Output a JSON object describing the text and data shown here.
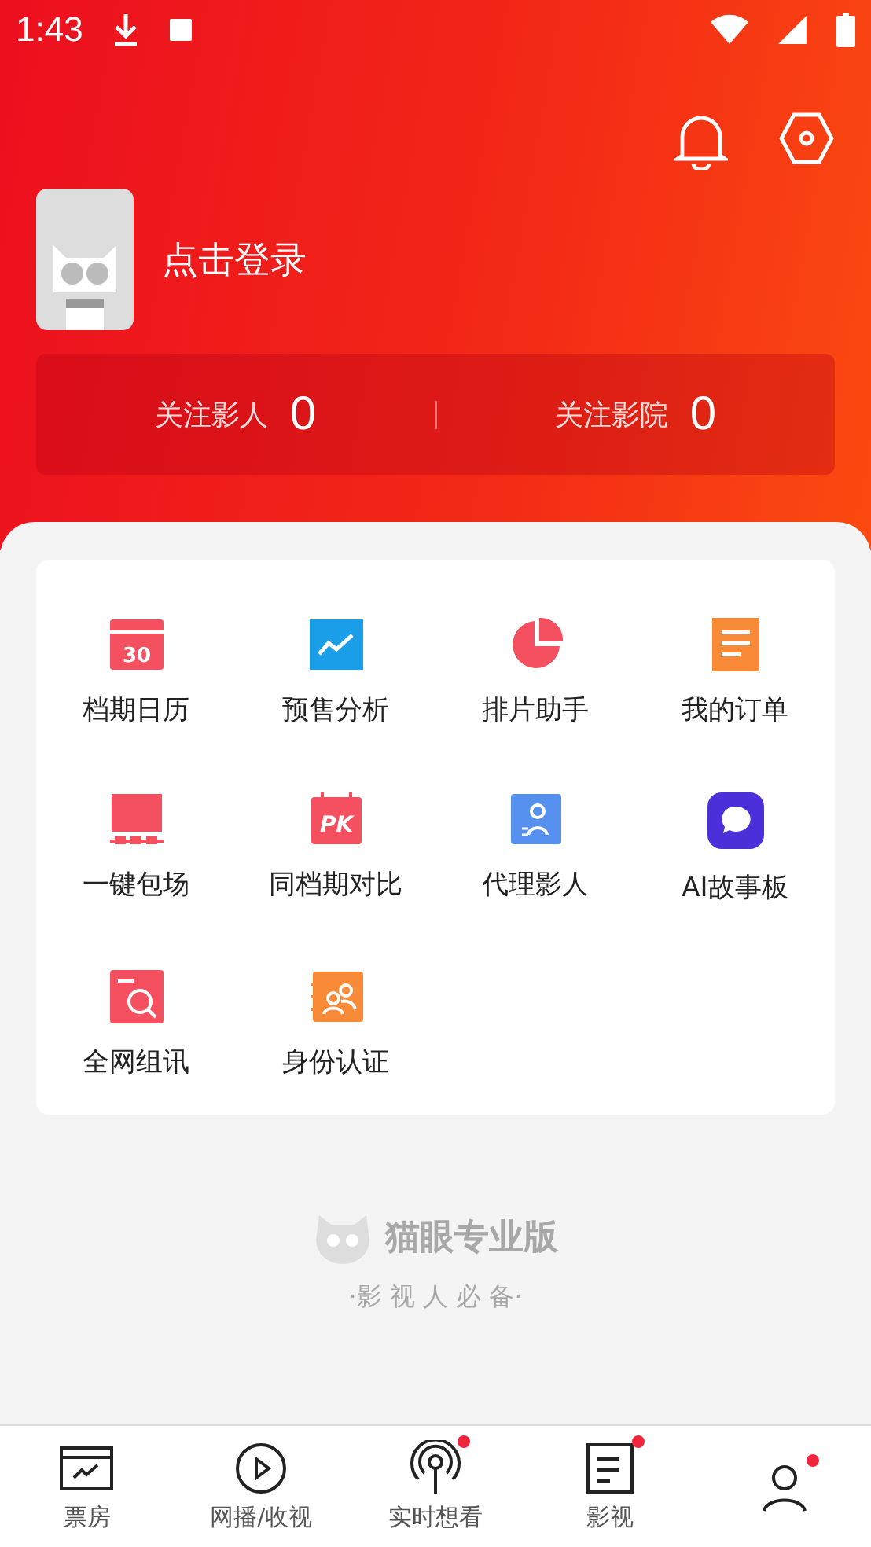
{
  "status_bar": {
    "time": "1:43"
  },
  "profile": {
    "login": "点击登录"
  },
  "stats": [
    {
      "label": "关注影人",
      "value": "0"
    },
    {
      "label": "关注影院",
      "value": "0"
    }
  ],
  "tools": [
    {
      "kind": "calendar",
      "label": "档期日历",
      "icon_text": "30"
    },
    {
      "kind": "trend",
      "label": "预售分析"
    },
    {
      "kind": "pie",
      "label": "排片助手"
    },
    {
      "kind": "order",
      "label": "我的订单"
    },
    {
      "kind": "screen",
      "label": "一键包场"
    },
    {
      "kind": "pk",
      "label": "同档期对比",
      "icon_text": "PK"
    },
    {
      "kind": "agent",
      "label": "代理影人"
    },
    {
      "kind": "chat",
      "label": "AI故事板"
    },
    {
      "kind": "search",
      "label": "全网组讯"
    },
    {
      "kind": "id",
      "label": "身份认证"
    }
  ],
  "brand": {
    "name": "猫眼专业版",
    "tagline": "·影 视 人 必 备·"
  },
  "tabs": [
    {
      "kind": "boxoffice",
      "label": "票房",
      "dot": false
    },
    {
      "kind": "play",
      "label": "网播/收视",
      "dot": false
    },
    {
      "kind": "broadcast",
      "label": "实时想看",
      "dot": true
    },
    {
      "kind": "doc",
      "label": "影视",
      "dot": true
    },
    {
      "kind": "person",
      "dot": true
    }
  ]
}
